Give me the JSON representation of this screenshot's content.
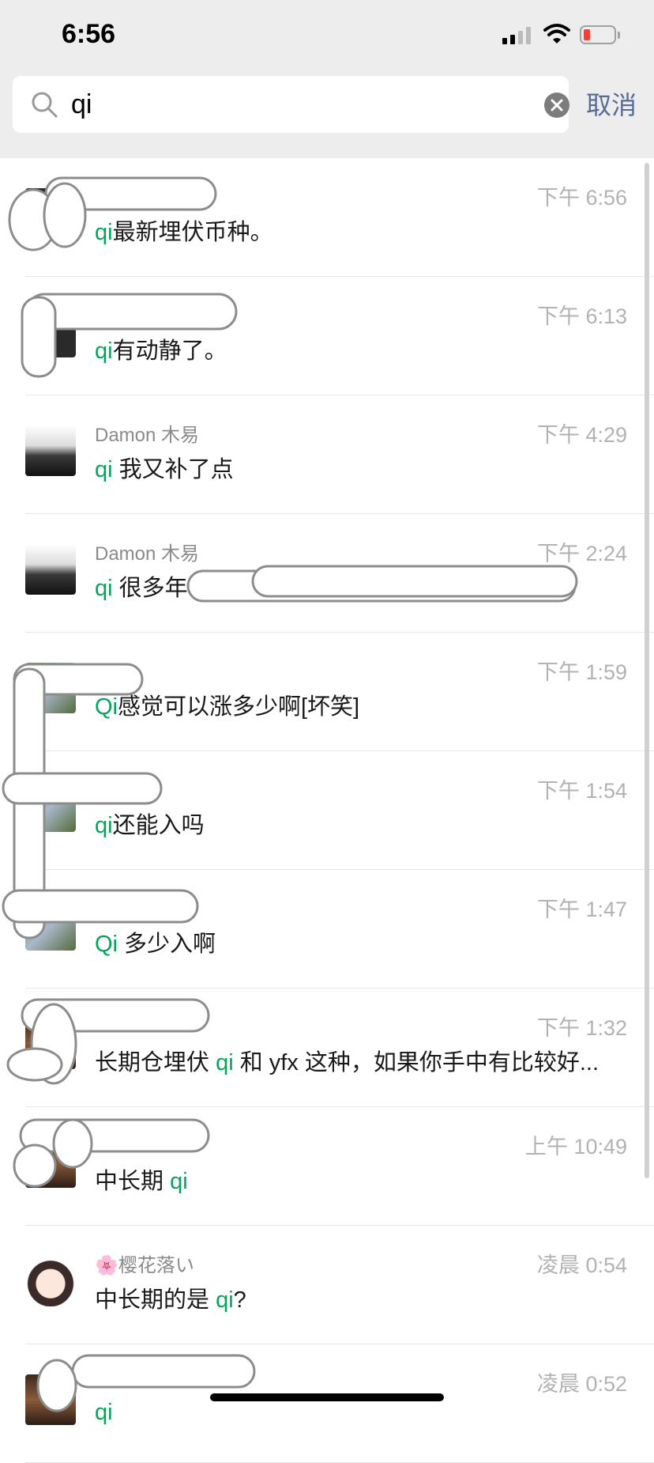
{
  "status": {
    "time": "6:56"
  },
  "search": {
    "query": "qi",
    "cancel_label": "取消"
  },
  "results": [
    {
      "name": "",
      "time": "下午 6:56",
      "pre": "",
      "kw": "qi",
      "post": "最新埋伏币种。",
      "avatar": "redacted"
    },
    {
      "name": "",
      "time": "下午 6:13",
      "pre": "",
      "kw": "qi",
      "post": "有动静了。",
      "avatar": "redacted"
    },
    {
      "name": "Damon 木易",
      "time": "下午 4:29",
      "pre": "",
      "kw": "qi",
      "post": " 我又补了点",
      "avatar": "photo"
    },
    {
      "name": "Damon 木易",
      "time": "下午 2:24",
      "pre": "",
      "kw": "qi",
      "post": " 很多年",
      "avatar": "photo"
    },
    {
      "name": "",
      "time": "下午 1:59",
      "pre": "",
      "kw": "Qi",
      "post": "感觉可以涨多少啊[坏笑]",
      "avatar": "nature"
    },
    {
      "name": "",
      "time": "下午 1:54",
      "pre": "",
      "kw": "qi",
      "post": "还能入吗",
      "avatar": "nature"
    },
    {
      "name": "",
      "time": "下午 1:47",
      "pre": "",
      "kw": "Qi",
      "post": " 多少入啊",
      "avatar": "nature"
    },
    {
      "name": "",
      "time": "下午 1:32",
      "pre": "长期仓埋伏 ",
      "kw": "qi",
      "post": " 和 yfx 这种，如果你手中有比较好...",
      "avatar": "city"
    },
    {
      "name": "",
      "time": "上午 10:49",
      "pre": "中长期 ",
      "kw": "qi",
      "post": "",
      "avatar": "city"
    },
    {
      "name": "🌸樱花落い",
      "time": "凌晨 0:54",
      "pre": "中长期的是 ",
      "kw": "qi",
      "post": "?",
      "avatar": "girl"
    },
    {
      "name": "",
      "time": "凌晨 0:52",
      "pre": "",
      "kw": "qi",
      "post": "",
      "avatar": "city"
    }
  ]
}
